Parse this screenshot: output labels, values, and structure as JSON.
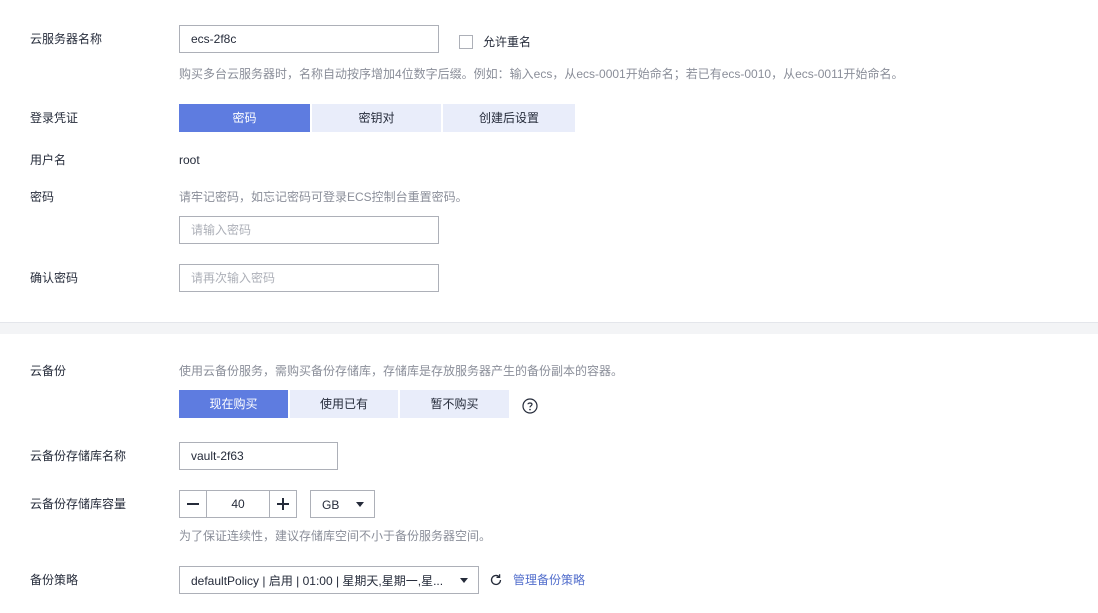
{
  "server_name": {
    "label": "云服务器名称",
    "value": "ecs-2f8c",
    "allow_duplicate_label": "允许重名",
    "hint": "购买多台云服务器时，名称自动按序增加4位数字后缀。例如：输入ecs，从ecs-0001开始命名；若已有ecs-0010，从ecs-0011开始命名。"
  },
  "login": {
    "label": "登录凭证",
    "options": [
      "密码",
      "密钥对",
      "创建后设置"
    ],
    "selected": "密码"
  },
  "username": {
    "label": "用户名",
    "value": "root"
  },
  "password": {
    "label": "密码",
    "hint": "请牢记密码，如忘记密码可登录ECS控制台重置密码。",
    "placeholder": "请输入密码"
  },
  "confirm_password": {
    "label": "确认密码",
    "placeholder": "请再次输入密码"
  },
  "cloud_backup": {
    "label": "云备份",
    "hint": "使用云备份服务，需购买备份存储库，存储库是存放服务器产生的备份副本的容器。",
    "options": [
      "现在购买",
      "使用已有",
      "暂不购买"
    ],
    "selected": "现在购买"
  },
  "vault_name": {
    "label": "云备份存储库名称",
    "value": "vault-2f63"
  },
  "vault_capacity": {
    "label": "云备份存储库容量",
    "value": "40",
    "unit": "GB",
    "hint": "为了保证连续性，建议存储库空间不小于备份服务器空间。"
  },
  "backup_policy": {
    "label": "备份策略",
    "value": "defaultPolicy | 启用 | 01:00 | 星期天,星期一,星...",
    "manage_link": "管理备份策略"
  },
  "colors": {
    "primary": "#5e7ce0",
    "segment_bg": "#e9edfa",
    "link": "#526ecc"
  }
}
